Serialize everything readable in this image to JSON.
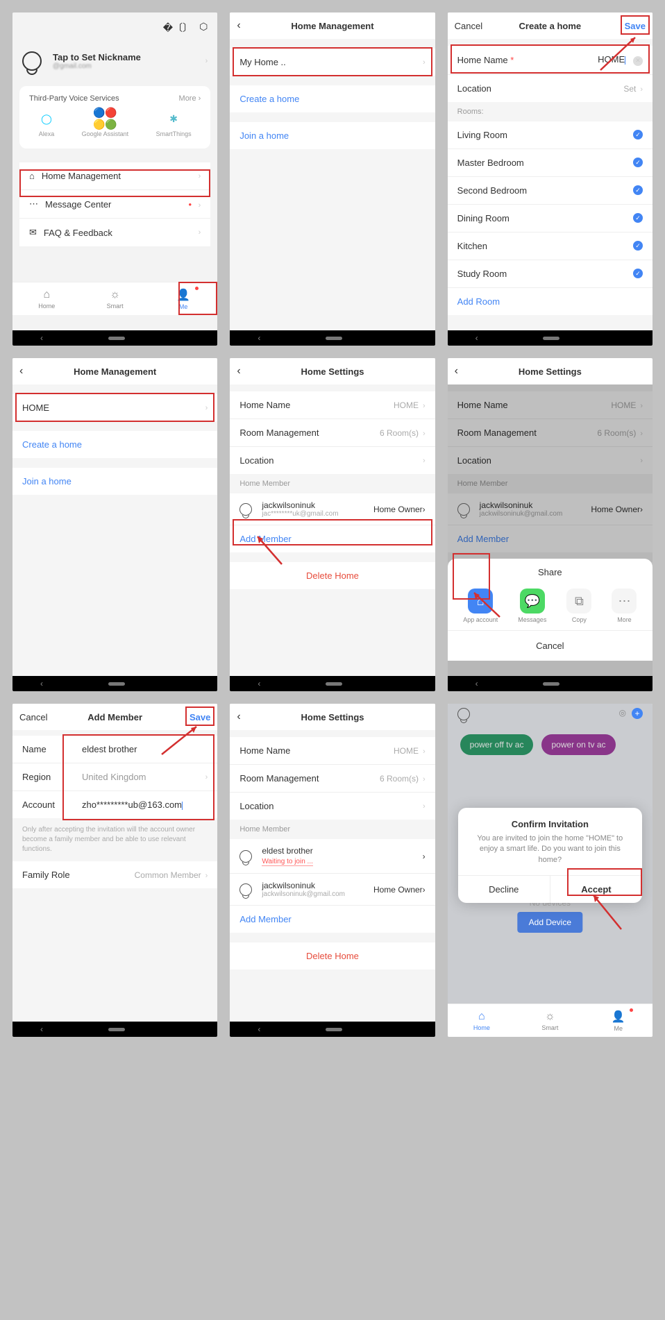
{
  "s1": {
    "nickname": "Tap to Set Nickname",
    "email": "@gmail.com",
    "voices_title": "Third-Party Voice Services",
    "more": "More",
    "voices": [
      "Alexa",
      "Google Assistant",
      "SmartThings"
    ],
    "menu": {
      "home": "Home Management",
      "msg": "Message Center",
      "faq": "FAQ & Feedback"
    },
    "tabs": {
      "home": "Home",
      "smart": "Smart",
      "me": "Me"
    }
  },
  "s2": {
    "title": "Home Management",
    "myhome": "My Home ..",
    "create": "Create a home",
    "join": "Join a home"
  },
  "s3": {
    "cancel": "Cancel",
    "title": "Create a home",
    "save": "Save",
    "homename_label": "Home Name",
    "homename_val": "HOME",
    "location": "Location",
    "set": "Set",
    "rooms_label": "Rooms:",
    "rooms": [
      "Living Room",
      "Master Bedroom",
      "Second Bedroom",
      "Dining Room",
      "Kitchen",
      "Study Room"
    ],
    "addroom": "Add Room"
  },
  "s4": {
    "title": "Home Management",
    "home": "HOME",
    "create": "Create a home",
    "join": "Join a home"
  },
  "s5": {
    "title": "Home Settings",
    "homename": "Home Name",
    "home_val": "HOME",
    "roommgmt": "Room Management",
    "rooms_val": "6 Room(s)",
    "location": "Location",
    "member_header": "Home Member",
    "member_name": "jackwilsoninuk",
    "member_email": "jac********uk@gmail.com",
    "role": "Home Owner",
    "add_member": "Add Member",
    "delete": "Delete Home"
  },
  "s6": {
    "title": "Home Settings",
    "homename": "Home Name",
    "home_val": "HOME",
    "roommgmt": "Room Management",
    "rooms_val": "6 Room(s)",
    "location": "Location",
    "member_header": "Home Member",
    "member_name": "jackwilsoninuk",
    "member_email": "jackwilsoninuk@gmail.com",
    "role": "Home Owner",
    "add_member": "Add Member",
    "delete": "Delete Home",
    "share_title": "Share",
    "share": {
      "app": "App account",
      "msg": "Messages",
      "copy": "Copy",
      "more": "More"
    },
    "share_cancel": "Cancel"
  },
  "s7": {
    "cancel": "Cancel",
    "title": "Add Member",
    "save": "Save",
    "name": "Name",
    "name_val": "eldest brother",
    "region": "Region",
    "region_val": "United Kingdom",
    "account": "Account",
    "account_val": "zho*********ub@163.com",
    "hint": "Only after accepting the invitation will the account owner become a family member and be able to use relevant functions.",
    "family_role": "Family Role",
    "family_role_val": "Common Member"
  },
  "s8": {
    "title": "Home Settings",
    "homename": "Home Name",
    "home_val": "HOME",
    "roommgmt": "Room Management",
    "rooms_val": "6 Room(s)",
    "location": "Location",
    "member_header": "Home Member",
    "m1_name": "eldest brother",
    "m1_status": "Waiting to join ...",
    "m2_name": "jackwilsoninuk",
    "m2_email": "jackwilsoninuk@gmail.com",
    "m2_role": "Home Owner",
    "add_member": "Add Member",
    "delete": "Delete Home"
  },
  "s9": {
    "pill1": "power off tv ac",
    "pill2": "power on tv ac",
    "modal_title": "Confirm Invitation",
    "modal_body": "You are invited to join the home \"HOME\" to enjoy a smart life. Do you want to join this home?",
    "decline": "Decline",
    "accept": "Accept",
    "no_devices": "No devices",
    "add_device": "Add Device",
    "tabs": {
      "home": "Home",
      "smart": "Smart",
      "me": "Me"
    }
  }
}
